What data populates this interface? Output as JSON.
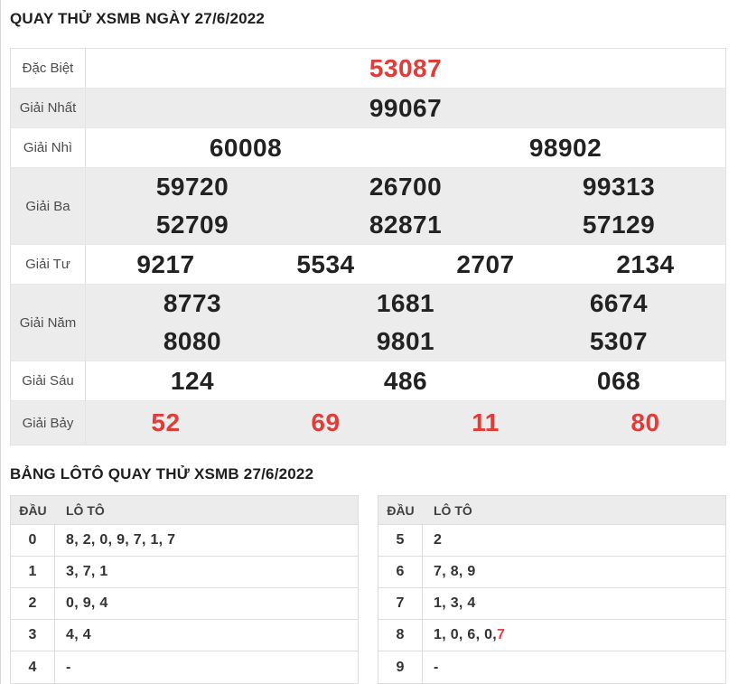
{
  "titles": {
    "main": "QUAY THỬ XSMB NGÀY 27/6/2022",
    "loto": "BẢNG LÔTÔ QUAY THỬ XSMB 27/6/2022"
  },
  "colors": {
    "highlight_red": "#e23b38",
    "loto_red": "#e3404a",
    "alt_row_bg": "#ececec",
    "border": "#dddddd"
  },
  "results_table": {
    "rows": [
      {
        "label": "Đặc Biệt",
        "highlight": "red",
        "lines": [
          [
            "53087"
          ]
        ]
      },
      {
        "label": "Giải Nhất",
        "lines": [
          [
            "99067"
          ]
        ]
      },
      {
        "label": "Giải Nhì",
        "lines": [
          [
            "60008",
            "98902"
          ]
        ]
      },
      {
        "label": "Giải Ba",
        "lines": [
          [
            "59720",
            "26700",
            "99313"
          ],
          [
            "52709",
            "82871",
            "57129"
          ]
        ]
      },
      {
        "label": "Giải Tư",
        "lines": [
          [
            "9217",
            "5534",
            "2707",
            "2134"
          ]
        ]
      },
      {
        "label": "Giải Năm",
        "lines": [
          [
            "8773",
            "1681",
            "6674"
          ],
          [
            "8080",
            "9801",
            "5307"
          ]
        ]
      },
      {
        "label": "Giải Sáu",
        "lines": [
          [
            "124",
            "486",
            "068"
          ]
        ]
      },
      {
        "label": "Giải Bảy",
        "highlight": "red",
        "lines": [
          [
            "52",
            "69",
            "11",
            "80"
          ]
        ]
      }
    ]
  },
  "loto_tables": {
    "header": {
      "dau": "ĐẦU",
      "loto": "LÔ TÔ"
    },
    "left": [
      {
        "dau": "0",
        "values": "8, 2, 0, 9, 7, 1, 7"
      },
      {
        "dau": "1",
        "values": "3, 7, 1"
      },
      {
        "dau": "2",
        "values": "0, 9, 4"
      },
      {
        "dau": "3",
        "values": "4, 4"
      },
      {
        "dau": "4",
        "values": "-"
      }
    ],
    "right": [
      {
        "dau": "5",
        "values": "2"
      },
      {
        "dau": "6",
        "values": "7, 8, 9"
      },
      {
        "dau": "7",
        "values": "1, 3, 4"
      },
      {
        "dau": "8",
        "values": "1, 0, 6, 0, ",
        "red_value": "7"
      },
      {
        "dau": "9",
        "values": "-"
      }
    ]
  }
}
